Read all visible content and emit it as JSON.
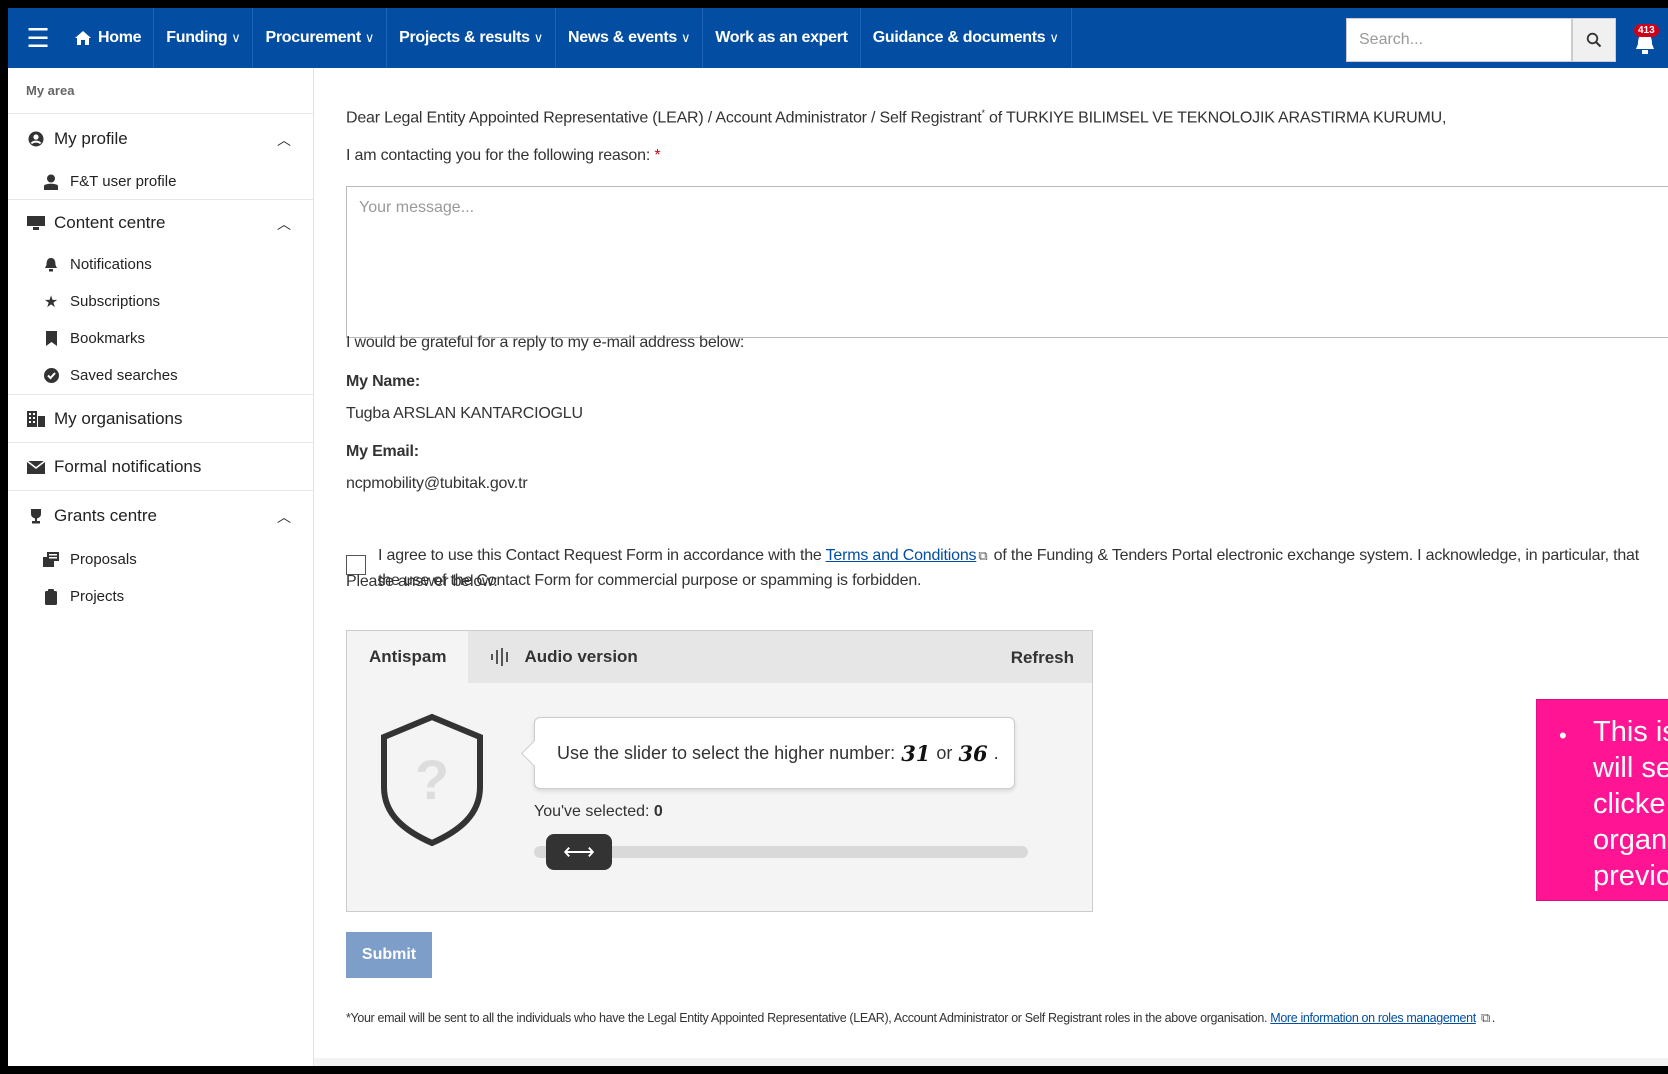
{
  "topnav": {
    "home": "Home",
    "items": [
      "Funding",
      "Procurement",
      "Projects & results",
      "News & events",
      "Work as an expert",
      "Guidance & documents"
    ],
    "search_placeholder": "Search...",
    "notification_count": "413"
  },
  "sidebar": {
    "header": "My area",
    "my_profile": "My profile",
    "ft_user_profile": "F&T user profile",
    "content_centre": "Content centre",
    "notifications": "Notifications",
    "subscriptions": "Subscriptions",
    "bookmarks": "Bookmarks",
    "saved_searches": "Saved searches",
    "my_organisations": "My organisations",
    "formal_notifications": "Formal notifications",
    "grants_centre": "Grants centre",
    "proposals": "Proposals",
    "projects": "Projects"
  },
  "form": {
    "greeting_a": "Dear Legal Entity Appointed Representative (LEAR) / Account Administrator / Self Registrant",
    "greeting_sup": "*",
    "greeting_b": " of TURKIYE BILIMSEL VE TEKNOLOJIK ARASTIRMA KURUMU,",
    "reason_label": "I am contacting you for the following reason:",
    "required_mark": "*",
    "message_placeholder": "Your message...",
    "reply_text": "I would be grateful for a reply to my e-mail address below:",
    "name_label": "My Name:",
    "name_value": "Tugba ARSLAN KANTARCIOGLU",
    "email_label": "My Email:",
    "email_value": "ncpmobility@tubitak.gov.tr",
    "agree_a": "I agree to use this Contact Request Form in accordance with the ",
    "terms_link": "Terms and Conditions",
    "agree_b": " of the Funding & Tenders Portal electronic exchange system. I acknowledge, in particular, that the use of the Contact Form for commercial purpose or spamming is forbidden.",
    "answer_label": "Please answer below:",
    "submit": "Submit",
    "footnote_a": "*Your email will be sent to all the individuals who have the Legal Entity Appointed Representative (LEAR), Account Administrator or Self Registrant roles in the above organisation. ",
    "footnote_link": "More information on roles management",
    "footnote_b": "."
  },
  "antispam": {
    "tab_antispam": "Antispam",
    "tab_audio": "Audio version",
    "refresh": "Refresh",
    "instruction": "Use the slider to select the higher number:",
    "num_a": "31",
    "or": "or",
    "num_b": "36",
    "period": ".",
    "selected_label": "You've selected:",
    "selected_value": "0"
  },
  "callout": {
    "lines": [
      "This is",
      "will se",
      "clicke",
      "organ",
      "previo"
    ]
  },
  "colors": {
    "nav_bg": "#034ea2",
    "callout_bg": "#ff1493",
    "submit_bg": "#7d9ec9",
    "required": "#d0021b"
  }
}
